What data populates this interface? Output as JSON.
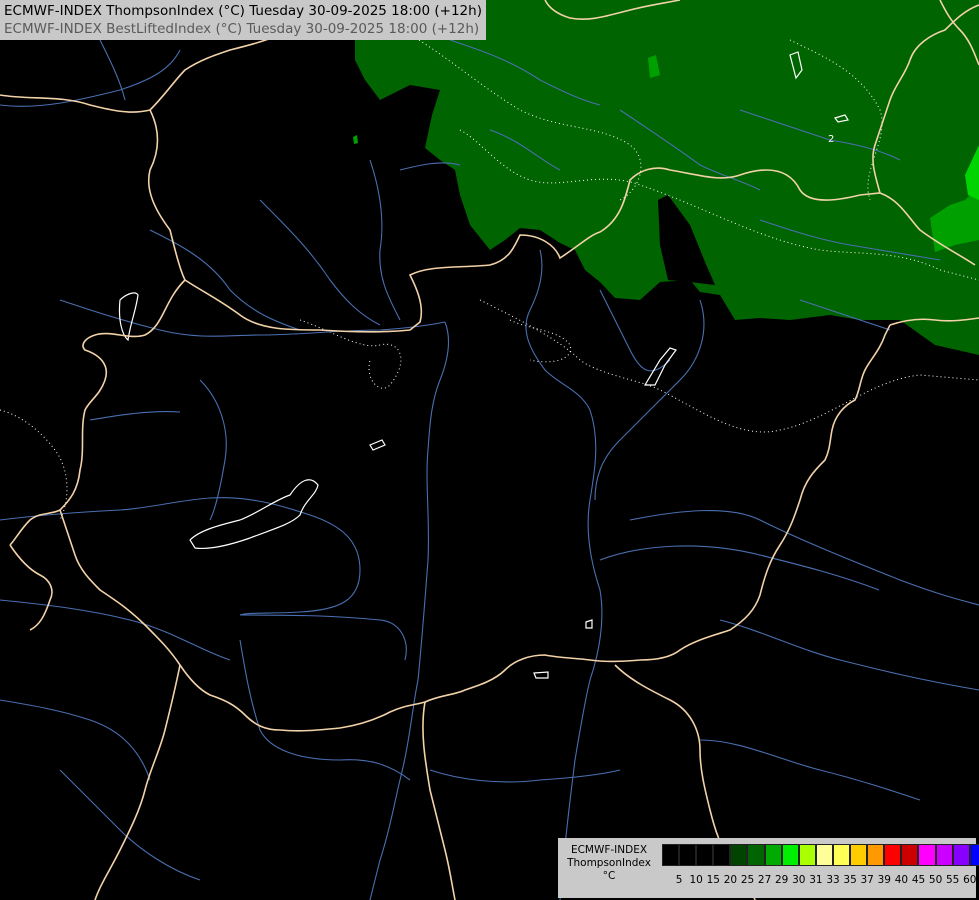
{
  "header": {
    "line1": "ECMWF-INDEX ThompsonIndex (°C) Tuesday 30-09-2025 18:00 (+12h)",
    "line2": "ECMWF-INDEX BestLiftedIndex (°C) Tuesday 30-09-2025 18:00 (+12h)"
  },
  "legend": {
    "model": "ECMWF-INDEX",
    "parameter": "ThompsonIndex",
    "unit": "°C",
    "colors": [
      "#000000",
      "#000000",
      "#000000",
      "#000000",
      "#004400",
      "#006400",
      "#00aa00",
      "#00ee00",
      "#aaff00",
      "#ffff99",
      "#ffff55",
      "#ffcc00",
      "#ff9900",
      "#ff0000",
      "#cc0000",
      "#ff00ff",
      "#cc00ff",
      "#8800ff",
      "#0000ff"
    ],
    "tick_labels": [
      "5",
      "10",
      "15",
      "20",
      "25",
      "27",
      "29",
      "30",
      "31",
      "33",
      "35",
      "37",
      "39",
      "40",
      "45",
      "50",
      "55",
      "60"
    ]
  },
  "map": {
    "field_colors": {
      "dark_green": "#006400",
      "mid_green": "#00a000",
      "bright_green": "#00d400"
    },
    "border_color": "#f2d2a8",
    "river_color": "#4a6fb0",
    "lake_color": "#ffffff",
    "contour_color": "#ffffff",
    "contour_label": "2"
  }
}
